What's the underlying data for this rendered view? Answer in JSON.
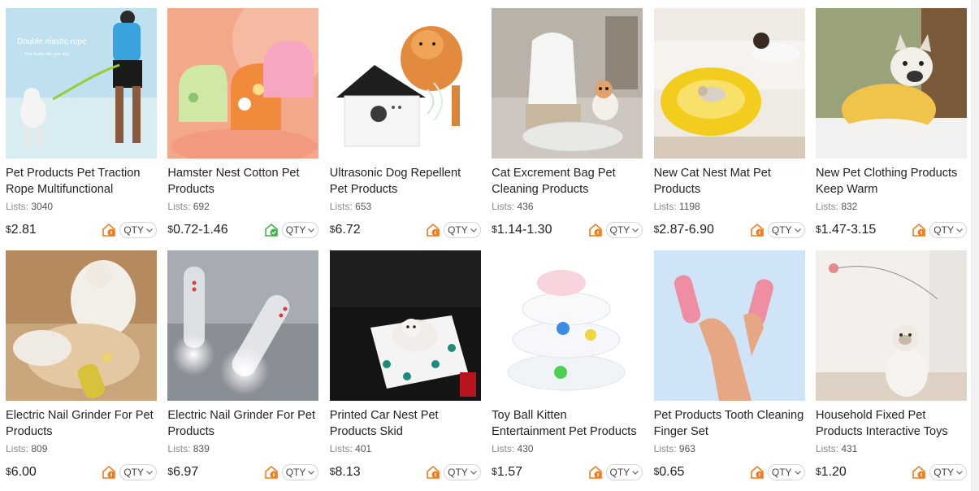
{
  "products": [
    {
      "title": "Pet Products Pet Traction Rope Multifunctional",
      "lists_label": "Lists:",
      "lists": "3040",
      "currency": "$",
      "price": "2.81",
      "store_icon": "store-badge-icon",
      "store_color": "#f07c1d",
      "qty": "QTY",
      "image_caption": "Double elastic rope",
      "image_subcaption": "Run freely with your dog"
    },
    {
      "title": "Hamster Nest Cotton Pet Products",
      "lists_label": "Lists:",
      "lists": "692",
      "currency": "$",
      "price": "0.72-1.46",
      "store_icon": "verified-store-icon",
      "store_color": "#3cb44a",
      "qty": "QTY"
    },
    {
      "title": "Ultrasonic Dog Repellent Pet Products",
      "lists_label": "Lists:",
      "lists": "653",
      "currency": "$",
      "price": "6.72",
      "store_icon": "store-badge-icon",
      "store_color": "#f07c1d",
      "qty": "QTY"
    },
    {
      "title": "Cat Excrement Bag Pet Cleaning Products",
      "lists_label": "Lists:",
      "lists": "436",
      "currency": "$",
      "price": "1.14-1.30",
      "store_icon": "store-badge-icon",
      "store_color": "#f07c1d",
      "qty": "QTY"
    },
    {
      "title": "New Cat Nest Mat Pet Products",
      "lists_label": "Lists:",
      "lists": "1198",
      "currency": "$",
      "price": "2.87-6.90",
      "store_icon": "store-badge-icon",
      "store_color": "#f07c1d",
      "qty": "QTY"
    },
    {
      "title": "New Pet Clothing Products Keep Warm",
      "lists_label": "Lists:",
      "lists": "832",
      "currency": "$",
      "price": "1.47-3.15",
      "store_icon": "store-badge-icon",
      "store_color": "#f07c1d",
      "qty": "QTY"
    },
    {
      "title": "Electric Nail Grinder For Pet Products",
      "lists_label": "Lists:",
      "lists": "809",
      "currency": "$",
      "price": "6.00",
      "store_icon": "store-badge-icon",
      "store_color": "#f07c1d",
      "qty": "QTY"
    },
    {
      "title": "Electric Nail Grinder For Pet Products",
      "lists_label": "Lists:",
      "lists": "839",
      "currency": "$",
      "price": "6.97",
      "store_icon": "store-badge-icon",
      "store_color": "#f07c1d",
      "qty": "QTY"
    },
    {
      "title": "Printed Car Nest Pet Products Skid",
      "lists_label": "Lists:",
      "lists": "401",
      "currency": "$",
      "price": "8.13",
      "store_icon": "store-badge-icon",
      "store_color": "#f07c1d",
      "qty": "QTY"
    },
    {
      "title": "Toy Ball Kitten Entertainment Pet Products",
      "lists_label": "Lists:",
      "lists": "430",
      "currency": "$",
      "price": "1.57",
      "store_icon": "store-badge-icon",
      "store_color": "#f07c1d",
      "qty": "QTY"
    },
    {
      "title": "Pet Products Tooth Cleaning Finger Set",
      "lists_label": "Lists:",
      "lists": "963",
      "currency": "$",
      "price": "0.65",
      "store_icon": "store-badge-icon",
      "store_color": "#f07c1d",
      "qty": "QTY"
    },
    {
      "title": "Household Fixed Pet Products Interactive Toys",
      "lists_label": "Lists:",
      "lists": "431",
      "currency": "$",
      "price": "1.20",
      "store_icon": "store-badge-icon",
      "store_color": "#f07c1d",
      "qty": "QTY"
    }
  ]
}
